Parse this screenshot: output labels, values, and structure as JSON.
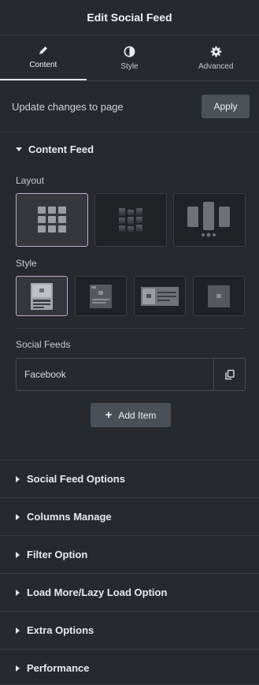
{
  "header": {
    "title": "Edit Social Feed"
  },
  "tabs": [
    {
      "label": "Content",
      "icon": "pencil-icon",
      "active": true
    },
    {
      "label": "Style",
      "icon": "half-circle-icon",
      "active": false
    },
    {
      "label": "Advanced",
      "icon": "gear-icon",
      "active": false
    }
  ],
  "update": {
    "text": "Update changes to page",
    "apply_label": "Apply"
  },
  "content_feed": {
    "title": "Content Feed",
    "layout_label": "Layout",
    "layout_options": [
      "grid",
      "masonry",
      "carousel"
    ],
    "selected_layout": "grid",
    "style_label": "Style",
    "style_options": [
      "style-1",
      "style-2",
      "style-3",
      "style-4"
    ],
    "selected_style": "style-1",
    "social_feeds_label": "Social Feeds",
    "feeds": [
      {
        "name": "Facebook"
      }
    ],
    "add_item_label": "Add Item"
  },
  "sections": [
    {
      "label": "Social Feed Options"
    },
    {
      "label": "Columns Manage"
    },
    {
      "label": "Filter Option"
    },
    {
      "label": "Load More/Lazy Load Option"
    },
    {
      "label": "Extra Options"
    },
    {
      "label": "Performance"
    }
  ],
  "colors": {
    "panel_bg": "#26292d",
    "selected_border": "#c9a6d6",
    "button_bg": "#4c5258"
  }
}
